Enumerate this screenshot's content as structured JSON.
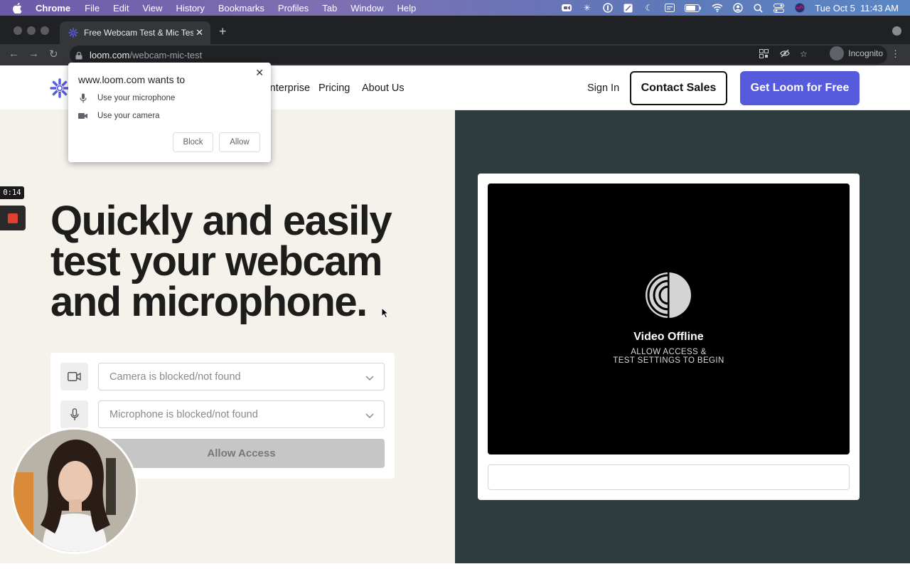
{
  "menubar": {
    "app": "Chrome",
    "items": [
      "File",
      "Edit",
      "View",
      "History",
      "Bookmarks",
      "Profiles",
      "Tab",
      "Window",
      "Help"
    ],
    "datetime": "Tue Oct 5  11:43 AM"
  },
  "browser": {
    "tab_title": "Free Webcam Test & Mic Test | Loom",
    "url_domain": "loom.com",
    "url_path": "/webcam-mic-test",
    "profile_label": "Incognito"
  },
  "site": {
    "nav": [
      "Enterprise",
      "Pricing",
      "About Us"
    ],
    "sign_in": "Sign In",
    "contact_sales": "Contact Sales",
    "get_loom": "Get Loom for Free",
    "brand_color": "#565ADD"
  },
  "hero": {
    "line1": "Quickly and easily",
    "line2": "test your webcam",
    "line3": "and microphone."
  },
  "form": {
    "camera_select": "Camera is blocked/not found",
    "mic_select": "Microphone is blocked/not found",
    "allow_button": "Allow Access"
  },
  "video": {
    "title": "Video Offline",
    "subtitle_line1": "ALLOW ACCESS &",
    "subtitle_line2": "TEST SETTINGS TO BEGIN"
  },
  "permission_popup": {
    "title": "www.loom.com wants to",
    "microphone": "Use your microphone",
    "camera": "Use your camera",
    "block": "Block",
    "allow": "Allow"
  },
  "recording": {
    "elapsed": "0:14"
  }
}
